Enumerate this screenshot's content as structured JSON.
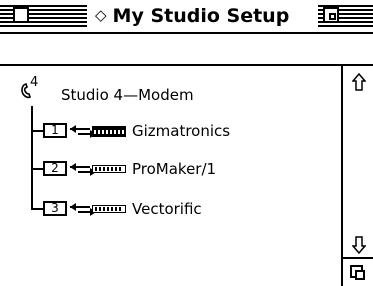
{
  "window": {
    "title": "My Studio Setup",
    "title_marker": "◇"
  },
  "tree": {
    "root": {
      "port_number": "4",
      "label": "Studio 4—Modem",
      "icon": "modem-phone-icon"
    },
    "devices": [
      {
        "port": "1",
        "name": "Gizmatronics",
        "icon": "device-keyboard-icon"
      },
      {
        "port": "2",
        "name": "ProMaker/1",
        "icon": "device-keyboard-icon"
      },
      {
        "port": "3",
        "name": "Vectorific",
        "icon": "device-keyboard-icon"
      }
    ]
  },
  "scrollbar": {
    "up_icon": "scroll-up-arrow-icon",
    "down_icon": "scroll-down-arrow-icon",
    "grow_icon": "grow-box-icon"
  }
}
